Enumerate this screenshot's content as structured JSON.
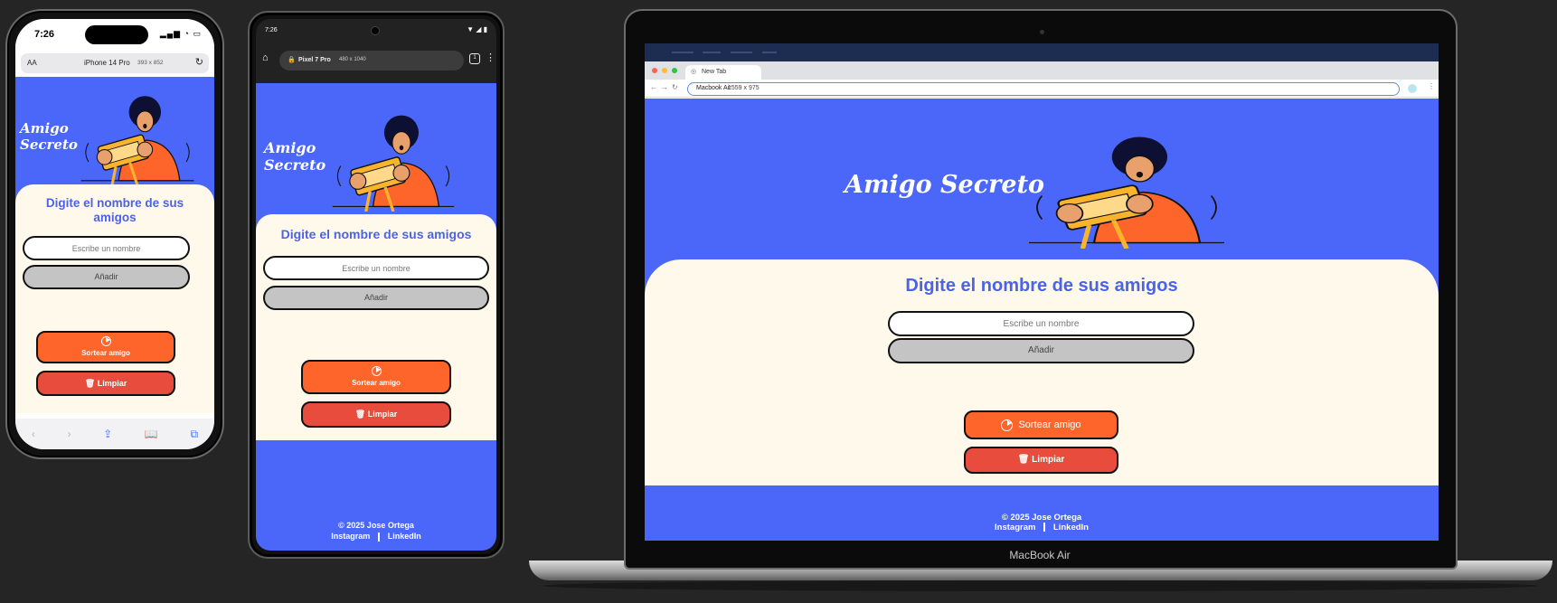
{
  "devices": {
    "iphone": {
      "time": "7:26",
      "text_size_label": "AA",
      "device_name": "iPhone 14 Pro",
      "dimensions": "393 x 852"
    },
    "pixel": {
      "time": "7:26",
      "device_name": "Pixel 7 Pro",
      "dimensions": "480 x 1040"
    },
    "macbook": {
      "tab_title": "New Tab",
      "device_name": "Macbook Air",
      "dimensions": "1559 x 975",
      "hardware_label": "MacBook Air"
    }
  },
  "app": {
    "title": "Amigo Secreto",
    "title_line1": "Amigo",
    "title_line2": "Secreto",
    "prompt": "Digite el nombre de sus amigos",
    "input_placeholder": "Escribe un nombre",
    "add_button": "Añadir",
    "draw_button": "Sortear amigo",
    "reset_button": "🗑 Limpiar",
    "footer_copyright": "© 2025 Jose Ortega",
    "footer_links": [
      "Instagram",
      "LinkedIn"
    ]
  },
  "colors": {
    "hero_blue": "#4a67fa",
    "card_cream": "#fff9eb",
    "title_blue": "#4b63e6",
    "draw_orange": "#fe652b",
    "reset_red": "#e74c3c",
    "add_gray": "#c4c4c4"
  },
  "icons": [
    "apple-icon",
    "reload-icon",
    "home-icon",
    "lock-icon",
    "play-circle-icon",
    "trash-icon",
    "wifi-icon",
    "battery-icon",
    "globe-icon"
  ]
}
